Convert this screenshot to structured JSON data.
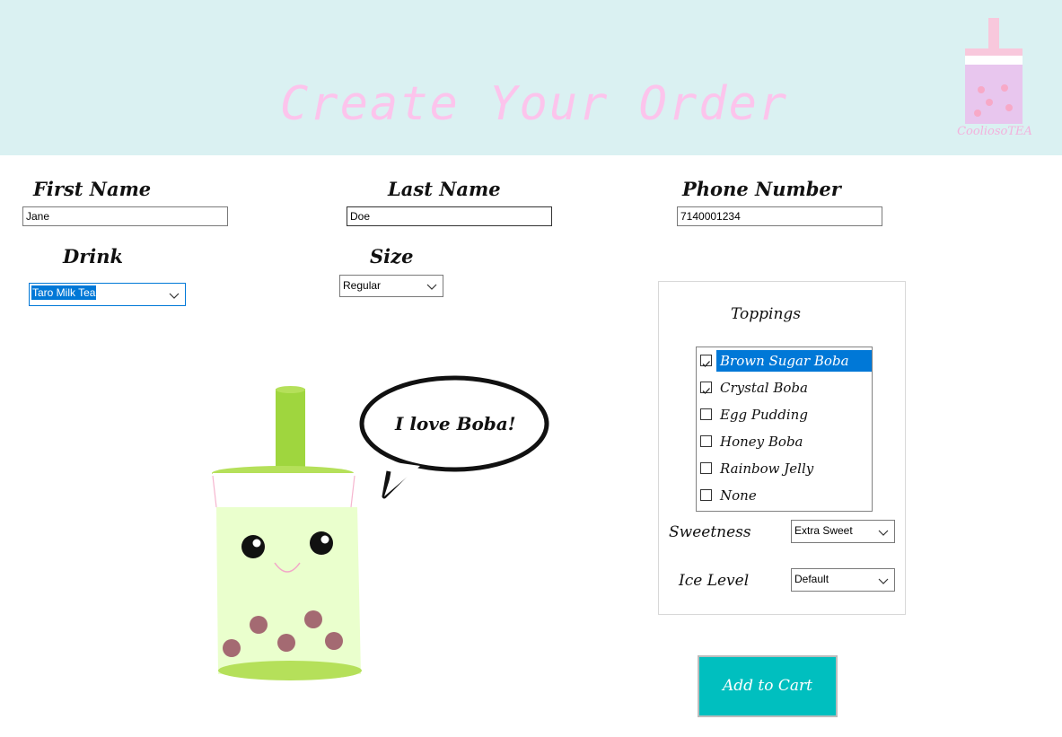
{
  "header": {
    "title": "Create Your Order",
    "logo_text": "CooliosoTEA",
    "colors": {
      "background": "#daf1f2",
      "title": "#fcc4ec"
    }
  },
  "form": {
    "first_name": {
      "label": "First Name",
      "value": "Jane"
    },
    "last_name": {
      "label": "Last Name",
      "value": "Doe"
    },
    "phone": {
      "label": "Phone Number",
      "value": "7140001234"
    },
    "drink": {
      "label": "Drink",
      "value": "Taro Milk Tea"
    },
    "size": {
      "label": "Size",
      "value": "Regular"
    }
  },
  "toppings": {
    "label": "Toppings",
    "items": [
      {
        "label": "Brown Sugar Boba",
        "checked": true,
        "selected": true
      },
      {
        "label": "Crystal Boba",
        "checked": true,
        "selected": false
      },
      {
        "label": "Egg Pudding",
        "checked": false,
        "selected": false
      },
      {
        "label": "Honey Boba",
        "checked": false,
        "selected": false
      },
      {
        "label": "Rainbow Jelly",
        "checked": false,
        "selected": false
      },
      {
        "label": "None",
        "checked": false,
        "selected": false
      }
    ]
  },
  "sweetness": {
    "label": "Sweetness",
    "value": "Extra Sweet"
  },
  "ice_level": {
    "label": "Ice Level",
    "value": "Default"
  },
  "actions": {
    "add_to_cart": "Add to Cart",
    "button_color": "#00bfbf"
  },
  "mascot": {
    "speech": "I love Boba!"
  }
}
